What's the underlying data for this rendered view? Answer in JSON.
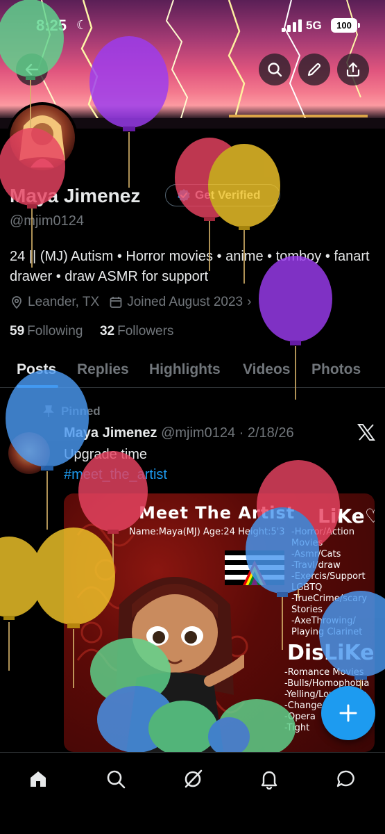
{
  "status_bar": {
    "time": "8:25",
    "network": "5G",
    "battery": "100"
  },
  "profile": {
    "name": "Maya Jimenez",
    "verify_label": "Get Verified",
    "handle": "@mjim0124",
    "bio": "24 || (MJ) Autism • Horror movies • anime • tomboy • fanart drawer • draw ASMR for support",
    "location": "Leander, TX",
    "joined": "Joined August 2023",
    "following_count": "59",
    "following_label": "Following",
    "followers_count": "32",
    "followers_label": "Followers"
  },
  "tabs": [
    {
      "label": "Posts"
    },
    {
      "label": "Replies"
    },
    {
      "label": "Highlights"
    },
    {
      "label": "Videos"
    },
    {
      "label": "Photos"
    }
  ],
  "post": {
    "pinned_label": "Pinned",
    "author": "Maya Jimenez",
    "handle": "@mjim0124",
    "date": "· 2/18/26",
    "text": "Upgrade time",
    "hashtag": "#meet_the_artist",
    "artwork": {
      "title": "Meet The Artist",
      "info": "Name:Maya(MJ) Age:24 Height:5'3",
      "like_heading": "LiKe♡",
      "likes": [
        "-Horror/Action",
        "Movies",
        "-Asmr/Cats",
        "-Travl/draw",
        "-Exercis/Support",
        "LGBTQ",
        "-TrueCrime/scary",
        "Stories",
        "-AxeThrowing/",
        "Playing Clarinet"
      ],
      "dislike_heading": "DisLiKe♡",
      "dislikes": [
        "-Romance Movies",
        "-Bulls/Homophobia",
        "-Yelling/Loud noise",
        "-Change",
        "-Opera",
        "-Tight"
      ]
    }
  },
  "colors": {
    "accent": "#1d9bf0",
    "background": "#000000",
    "muted": "#71767b",
    "text": "#e7e9ea"
  }
}
